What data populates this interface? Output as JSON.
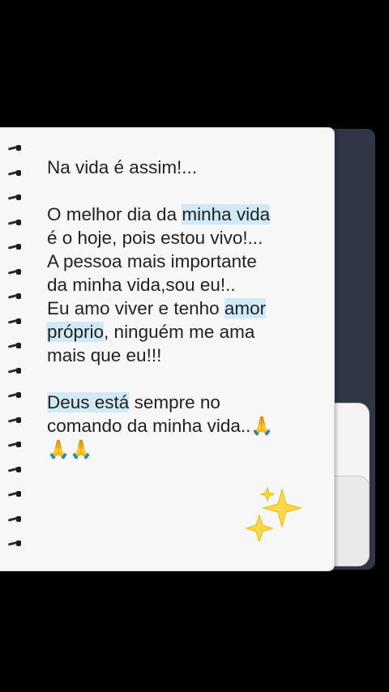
{
  "note": {
    "title": "Na vida é assim!...",
    "lines": [
      {
        "before": "O melhor dia da ",
        "highlight": "minha vida",
        "after": ""
      },
      {
        "before": "é o hoje, pois  estou vivo!...",
        "highlight": "",
        "after": ""
      },
      {
        "before": "A pessoa mais importante",
        "highlight": "",
        "after": ""
      },
      {
        "before": "da minha vida,sou eu!..",
        "highlight": "",
        "after": ""
      },
      {
        "before": "Eu amo viver e tenho ",
        "highlight": "amor ",
        "after": ""
      },
      {
        "before": "",
        "highlight": "próprio",
        "after": ", ninguém me ama"
      },
      {
        "before": "mais que eu!!!",
        "highlight": "",
        "after": ""
      }
    ],
    "closing": [
      {
        "before": "",
        "highlight": "Deus está",
        "after": " sempre no"
      },
      {
        "before": "comando da minha vida..🙏",
        "highlight": "",
        "after": ""
      },
      {
        "before": "🙏🙏",
        "highlight": "",
        "after": ""
      }
    ],
    "sparkles_icon": "sparkles-icon"
  },
  "colors": {
    "background": "#000000",
    "paper": "#f7f7f7",
    "highlight": "#cfe9f7",
    "cover": "#2f3645"
  }
}
